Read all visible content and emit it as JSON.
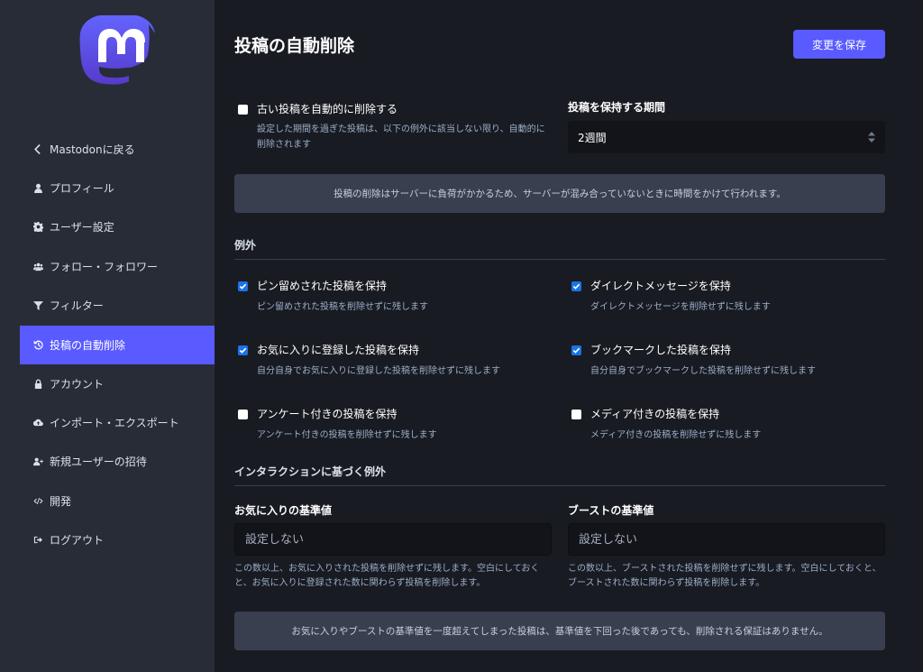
{
  "sidebar": {
    "items": [
      {
        "label": "Mastodonに戻る",
        "icon": "chevron-left-icon"
      },
      {
        "label": "プロフィール",
        "icon": "user-icon"
      },
      {
        "label": "ユーザー設定",
        "icon": "gear-icon"
      },
      {
        "label": "フォロー・フォロワー",
        "icon": "users-icon"
      },
      {
        "label": "フィルター",
        "icon": "filter-icon"
      },
      {
        "label": "投稿の自動削除",
        "icon": "history-icon",
        "active": true
      },
      {
        "label": "アカウント",
        "icon": "lock-icon"
      },
      {
        "label": "インポート・エクスポート",
        "icon": "cloud-icon"
      },
      {
        "label": "新規ユーザーの招待",
        "icon": "user-plus-icon"
      },
      {
        "label": "開発",
        "icon": "code-icon"
      },
      {
        "label": "ログアウト",
        "icon": "sign-out-icon"
      }
    ]
  },
  "main": {
    "title": "投稿の自動削除",
    "save_label": "変更を保存",
    "auto_delete": {
      "label": "古い投稿を自動的に削除する",
      "hint": "設定した期間を過ぎた投稿は、以下の例外に該当しない限り、自動的に削除されます",
      "checked": false
    },
    "period": {
      "label": "投稿を保持する期間",
      "value": "2週間"
    },
    "notice1": "投稿の削除はサーバーに負荷がかかるため、サーバーが混み合っていないときに時間をかけて行われます。",
    "exceptions_title": "例外",
    "exceptions": [
      {
        "label": "ピン留めされた投稿を保持",
        "hint": "ピン留めされた投稿を削除せずに残します",
        "checked": true
      },
      {
        "label": "ダイレクトメッセージを保持",
        "hint": "ダイレクトメッセージを削除せずに残します",
        "checked": true
      },
      {
        "label": "お気に入りに登録した投稿を保持",
        "hint": "自分自身でお気に入りに登録した投稿を削除せずに残します",
        "checked": true
      },
      {
        "label": "ブックマークした投稿を保持",
        "hint": "自分自身でブックマークした投稿を削除せずに残します",
        "checked": true
      },
      {
        "label": "アンケート付きの投稿を保持",
        "hint": "アンケート付きの投稿を削除せずに残します",
        "checked": false
      },
      {
        "label": "メディア付きの投稿を保持",
        "hint": "メディア付きの投稿を削除せずに残します",
        "checked": false
      }
    ],
    "interaction_title": "インタラクションに基づく例外",
    "fav_threshold": {
      "label": "お気に入りの基準値",
      "placeholder": "設定しない",
      "hint": "この数以上、お気に入りされた投稿を削除せずに残します。空白にしておくと、お気に入りに登録された数に関わらず投稿を削除します。"
    },
    "boost_threshold": {
      "label": "ブーストの基準値",
      "placeholder": "設定しない",
      "hint": "この数以上、ブーストされた投稿を削除せずに残します。空白にしておくと、ブーストされた数に関わらず投稿を削除します。"
    },
    "notice2": "お気に入りやブーストの基準値を一度超えてしまった投稿は、基準値を下回った後であっても、削除される保証はありません。"
  },
  "colors": {
    "accent": "#595aff",
    "sidebar_bg": "#282c37",
    "page_bg": "#191b22",
    "checkbox_checked": "#1a73e8"
  }
}
